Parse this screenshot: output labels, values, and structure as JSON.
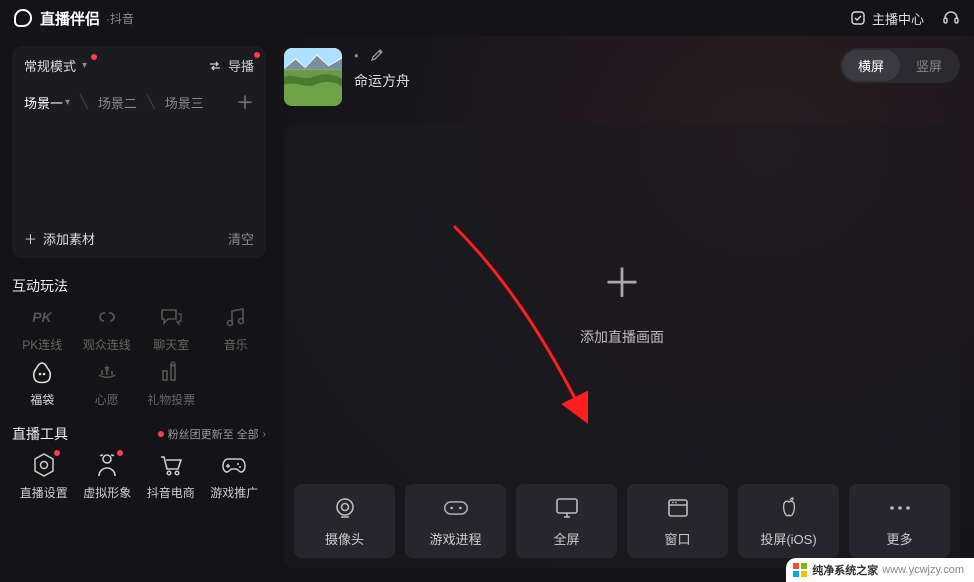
{
  "topbar": {
    "app_title": "直播伴侣",
    "app_subtitle": "·抖音",
    "host_center": "主播中心"
  },
  "sidebar": {
    "mode_label": "常规模式",
    "daobo_label": "导播",
    "scenes": [
      "场景一",
      "场景二",
      "场景三"
    ],
    "add_material": "添加素材",
    "clear": "清空",
    "interact_title": "互动玩法",
    "interact_items": [
      "PK连线",
      "观众连线",
      "聊天室",
      "音乐",
      "福袋",
      "心愿",
      "礼物投票"
    ],
    "tools_title": "直播工具",
    "tools_update": "粉丝团更新至 全部",
    "tools_items": [
      "直播设置",
      "虚拟形象",
      "抖音电商",
      "游戏推广"
    ]
  },
  "main": {
    "room_status_dot": "•",
    "room_name": "命运方舟",
    "orientation": {
      "landscape": "横屏",
      "portrait": "竖屏"
    },
    "canvas_add_label": "添加直播画面",
    "sources": [
      "摄像头",
      "游戏进程",
      "全屏",
      "窗口",
      "投屏(iOS)",
      "更多"
    ]
  },
  "watermark": {
    "text": "纯净系统之家",
    "url": "www.ycwjzy.com"
  }
}
